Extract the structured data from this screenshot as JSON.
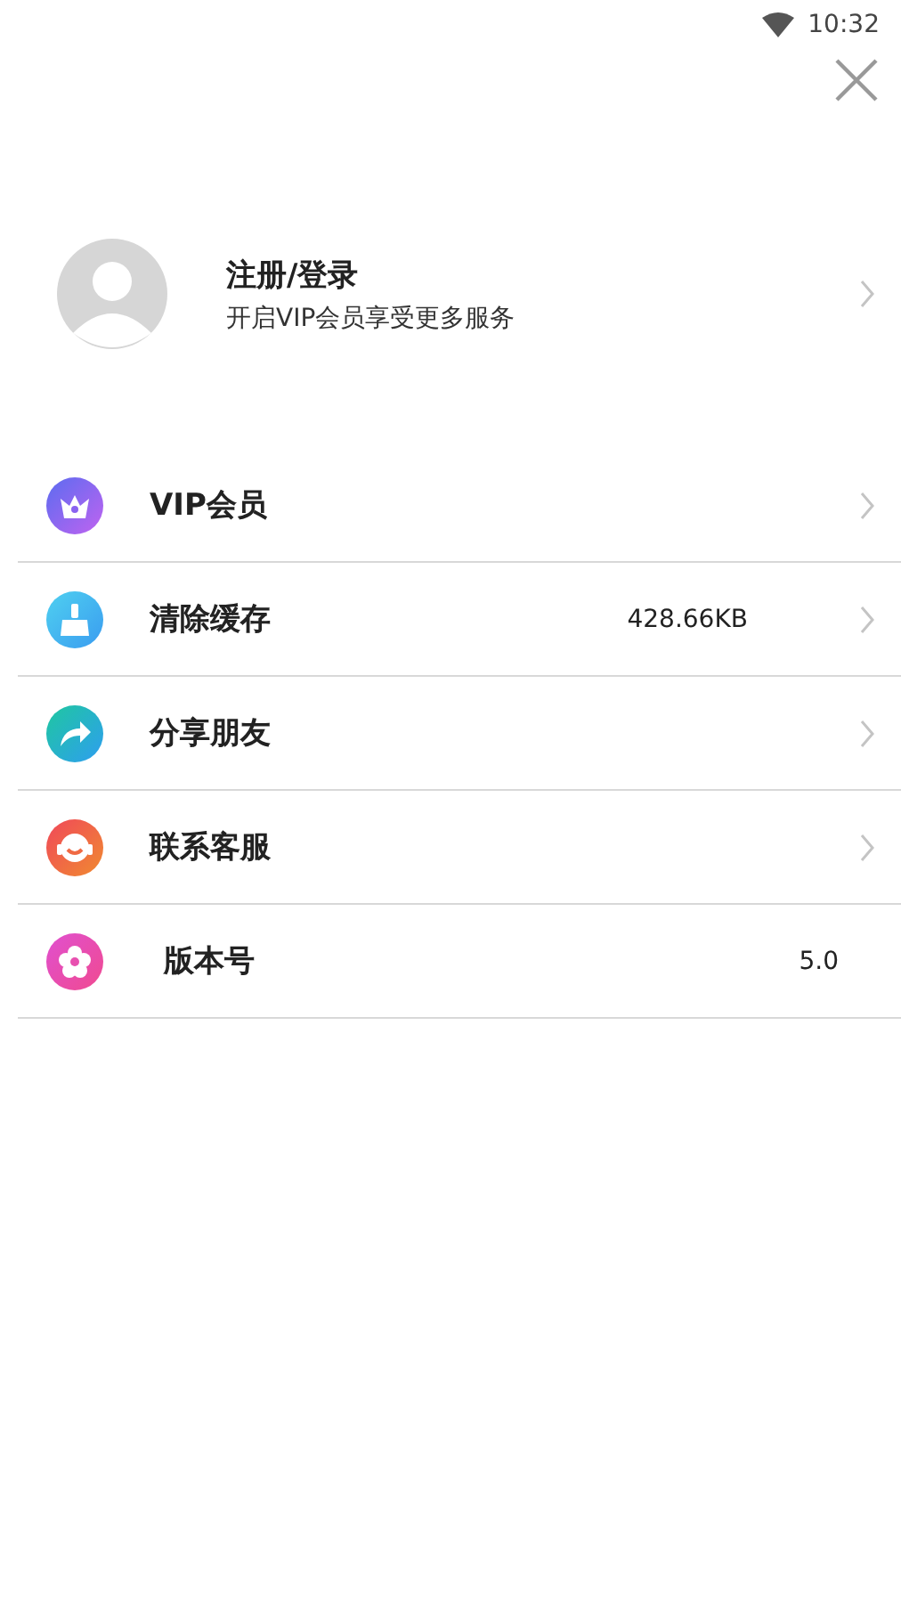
{
  "status_bar": {
    "time": "10:32"
  },
  "profile": {
    "title": "注册/登录",
    "subtitle": "开启VIP会员享受更多服务",
    "chevron": true
  },
  "menu": [
    {
      "kind": "crown",
      "label": "VIP会员",
      "chevron": true
    },
    {
      "kind": "broom",
      "label": "清除缓存",
      "value": "428.66KB",
      "chevron": true
    },
    {
      "kind": "share",
      "label": "分享朋友",
      "chevron": true
    },
    {
      "kind": "headset",
      "label": "联系客服",
      "chevron": true
    },
    {
      "kind": "flower",
      "label": "版本号",
      "value": "5.0",
      "chevron": false
    }
  ]
}
